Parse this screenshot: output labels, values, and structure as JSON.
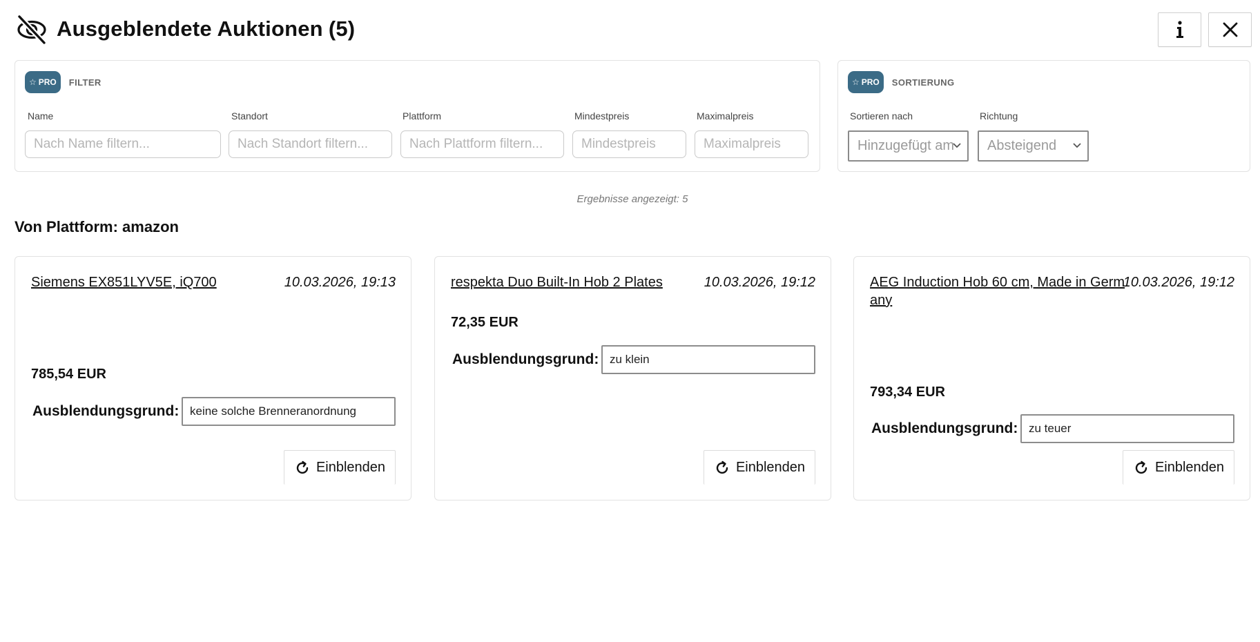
{
  "header": {
    "title": "Ausgeblendete Auktionen",
    "count": "(5)",
    "info_label": "i",
    "close_label": "×"
  },
  "filter": {
    "badge": "PRO",
    "title": "FILTER",
    "fields": [
      {
        "label": "Name",
        "placeholder": "Nach Name filtern..."
      },
      {
        "label": "Standort",
        "placeholder": "Nach Standort filtern..."
      },
      {
        "label": "Plattform",
        "placeholder": "Nach Plattform filtern..."
      },
      {
        "label": "Mindestpreis",
        "placeholder": "Mindestpreis"
      },
      {
        "label": "Maximalpreis",
        "placeholder": "Maximalpreis"
      }
    ]
  },
  "sort": {
    "badge": "PRO",
    "title": "SORTIERUNG",
    "by_label": "Sortieren nach",
    "by_value": "Hinzugefügt am",
    "dir_label": "Richtung",
    "dir_value": "Absteigend"
  },
  "results_text": "Ergebnisse angezeigt: 5",
  "section_title": "Von Plattform: amazon",
  "cards": [
    {
      "title": "Siemens EX851LYV5E, iQ700",
      "date": "10.03.2026, 19:13",
      "price": "785,54 EUR",
      "reason_label": "Ausblendungsgrund:",
      "reason": "keine solche Brenneranordnung",
      "button": "Einblenden"
    },
    {
      "title": "respekta Duo Built-In Hob 2 Plates",
      "date": "10.03.2026, 19:12",
      "price": "72,35 EUR",
      "reason_label": "Ausblendungsgrund:",
      "reason": "zu klein",
      "button": "Einblenden"
    },
    {
      "title": "AEG Induction Hob 60 cm, Made in Germany",
      "date": "10.03.2026, 19:12",
      "price": "793,34 EUR",
      "reason_label": "Ausblendungsgrund:",
      "reason": "zu teuer",
      "button": "Einblenden"
    }
  ],
  "icons": {
    "header": "eye-off-icon",
    "star": "star-icon",
    "refresh": "refresh-icon",
    "chevron": "chevron-down-icon"
  },
  "colors": {
    "pro_badge": "#3b6b86"
  }
}
